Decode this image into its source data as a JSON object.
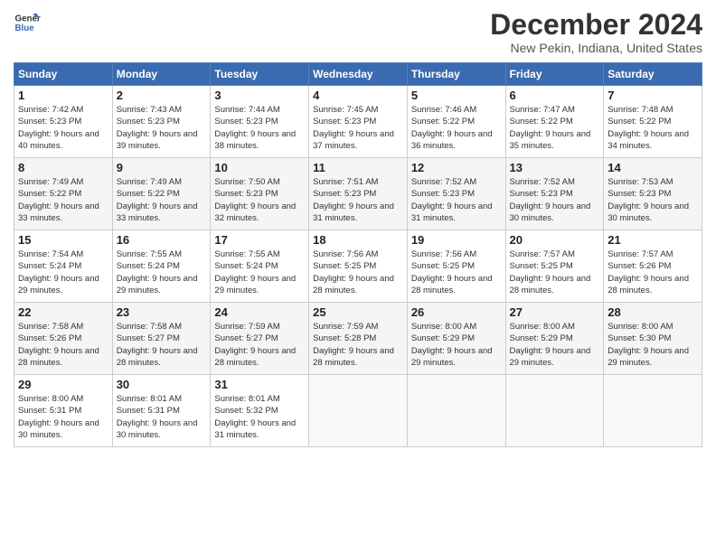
{
  "header": {
    "logo_line1": "General",
    "logo_line2": "Blue",
    "month_title": "December 2024",
    "location": "New Pekin, Indiana, United States"
  },
  "weekdays": [
    "Sunday",
    "Monday",
    "Tuesday",
    "Wednesday",
    "Thursday",
    "Friday",
    "Saturday"
  ],
  "weeks": [
    [
      {
        "day": "1",
        "info": "Sunrise: 7:42 AM\nSunset: 5:23 PM\nDaylight: 9 hours and 40 minutes."
      },
      {
        "day": "2",
        "info": "Sunrise: 7:43 AM\nSunset: 5:23 PM\nDaylight: 9 hours and 39 minutes."
      },
      {
        "day": "3",
        "info": "Sunrise: 7:44 AM\nSunset: 5:23 PM\nDaylight: 9 hours and 38 minutes."
      },
      {
        "day": "4",
        "info": "Sunrise: 7:45 AM\nSunset: 5:23 PM\nDaylight: 9 hours and 37 minutes."
      },
      {
        "day": "5",
        "info": "Sunrise: 7:46 AM\nSunset: 5:22 PM\nDaylight: 9 hours and 36 minutes."
      },
      {
        "day": "6",
        "info": "Sunrise: 7:47 AM\nSunset: 5:22 PM\nDaylight: 9 hours and 35 minutes."
      },
      {
        "day": "7",
        "info": "Sunrise: 7:48 AM\nSunset: 5:22 PM\nDaylight: 9 hours and 34 minutes."
      }
    ],
    [
      {
        "day": "8",
        "info": "Sunrise: 7:49 AM\nSunset: 5:22 PM\nDaylight: 9 hours and 33 minutes."
      },
      {
        "day": "9",
        "info": "Sunrise: 7:49 AM\nSunset: 5:22 PM\nDaylight: 9 hours and 33 minutes."
      },
      {
        "day": "10",
        "info": "Sunrise: 7:50 AM\nSunset: 5:23 PM\nDaylight: 9 hours and 32 minutes."
      },
      {
        "day": "11",
        "info": "Sunrise: 7:51 AM\nSunset: 5:23 PM\nDaylight: 9 hours and 31 minutes."
      },
      {
        "day": "12",
        "info": "Sunrise: 7:52 AM\nSunset: 5:23 PM\nDaylight: 9 hours and 31 minutes."
      },
      {
        "day": "13",
        "info": "Sunrise: 7:52 AM\nSunset: 5:23 PM\nDaylight: 9 hours and 30 minutes."
      },
      {
        "day": "14",
        "info": "Sunrise: 7:53 AM\nSunset: 5:23 PM\nDaylight: 9 hours and 30 minutes."
      }
    ],
    [
      {
        "day": "15",
        "info": "Sunrise: 7:54 AM\nSunset: 5:24 PM\nDaylight: 9 hours and 29 minutes."
      },
      {
        "day": "16",
        "info": "Sunrise: 7:55 AM\nSunset: 5:24 PM\nDaylight: 9 hours and 29 minutes."
      },
      {
        "day": "17",
        "info": "Sunrise: 7:55 AM\nSunset: 5:24 PM\nDaylight: 9 hours and 29 minutes."
      },
      {
        "day": "18",
        "info": "Sunrise: 7:56 AM\nSunset: 5:25 PM\nDaylight: 9 hours and 28 minutes."
      },
      {
        "day": "19",
        "info": "Sunrise: 7:56 AM\nSunset: 5:25 PM\nDaylight: 9 hours and 28 minutes."
      },
      {
        "day": "20",
        "info": "Sunrise: 7:57 AM\nSunset: 5:25 PM\nDaylight: 9 hours and 28 minutes."
      },
      {
        "day": "21",
        "info": "Sunrise: 7:57 AM\nSunset: 5:26 PM\nDaylight: 9 hours and 28 minutes."
      }
    ],
    [
      {
        "day": "22",
        "info": "Sunrise: 7:58 AM\nSunset: 5:26 PM\nDaylight: 9 hours and 28 minutes."
      },
      {
        "day": "23",
        "info": "Sunrise: 7:58 AM\nSunset: 5:27 PM\nDaylight: 9 hours and 28 minutes."
      },
      {
        "day": "24",
        "info": "Sunrise: 7:59 AM\nSunset: 5:27 PM\nDaylight: 9 hours and 28 minutes."
      },
      {
        "day": "25",
        "info": "Sunrise: 7:59 AM\nSunset: 5:28 PM\nDaylight: 9 hours and 28 minutes."
      },
      {
        "day": "26",
        "info": "Sunrise: 8:00 AM\nSunset: 5:29 PM\nDaylight: 9 hours and 29 minutes."
      },
      {
        "day": "27",
        "info": "Sunrise: 8:00 AM\nSunset: 5:29 PM\nDaylight: 9 hours and 29 minutes."
      },
      {
        "day": "28",
        "info": "Sunrise: 8:00 AM\nSunset: 5:30 PM\nDaylight: 9 hours and 29 minutes."
      }
    ],
    [
      {
        "day": "29",
        "info": "Sunrise: 8:00 AM\nSunset: 5:31 PM\nDaylight: 9 hours and 30 minutes."
      },
      {
        "day": "30",
        "info": "Sunrise: 8:01 AM\nSunset: 5:31 PM\nDaylight: 9 hours and 30 minutes."
      },
      {
        "day": "31",
        "info": "Sunrise: 8:01 AM\nSunset: 5:32 PM\nDaylight: 9 hours and 31 minutes."
      },
      {
        "day": "",
        "info": ""
      },
      {
        "day": "",
        "info": ""
      },
      {
        "day": "",
        "info": ""
      },
      {
        "day": "",
        "info": ""
      }
    ]
  ]
}
